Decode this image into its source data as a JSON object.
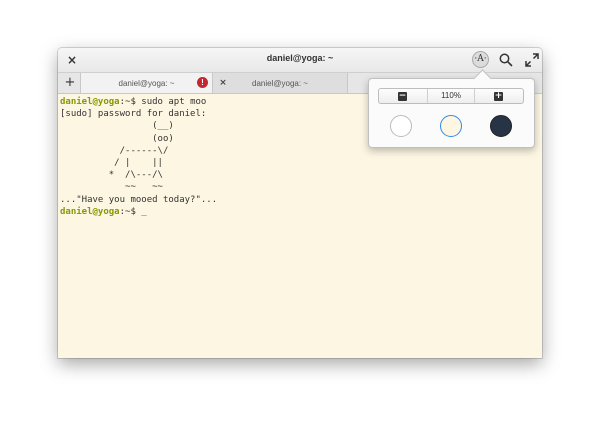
{
  "window": {
    "title": "daniel@yoga: ~",
    "close_icon": "close-icon",
    "zoom_icon_glyph": "·A·",
    "search_icon": "search-icon",
    "maximize_icon": "maximize-icon"
  },
  "tabs": {
    "new_tab_glyph": "+",
    "items": [
      {
        "label": "daniel@yoga: ~",
        "active": true,
        "has_alert": true,
        "alert_glyph": "!"
      },
      {
        "label": "daniel@yoga: ~",
        "active": false,
        "close_glyph": "×"
      }
    ]
  },
  "terminal": {
    "prompt_user": "daniel@yoga",
    "prompt_rest": ":~$ ",
    "command": "sudo apt moo",
    "output": [
      "[sudo] password for daniel:",
      "                 (__)",
      "                 (oo)",
      "           /------\\/",
      "          / |    ||",
      "         *  /\\---/\\",
      "            ~~   ~~",
      "...\"Have you mooed today?\"..."
    ],
    "cursor": "_"
  },
  "zoom_popover": {
    "zoom_out_glyph": "−",
    "zoom_level": "110%",
    "zoom_in_glyph": "+",
    "themes": [
      "light",
      "solarized-light",
      "dark"
    ],
    "selected_theme": "solarized-light"
  },
  "colors": {
    "terminal_bg": "#fdf6e3",
    "prompt_user": "#859900",
    "alert": "#c6262e",
    "selected_outline": "#3689e6",
    "dark_theme": "#273445"
  }
}
